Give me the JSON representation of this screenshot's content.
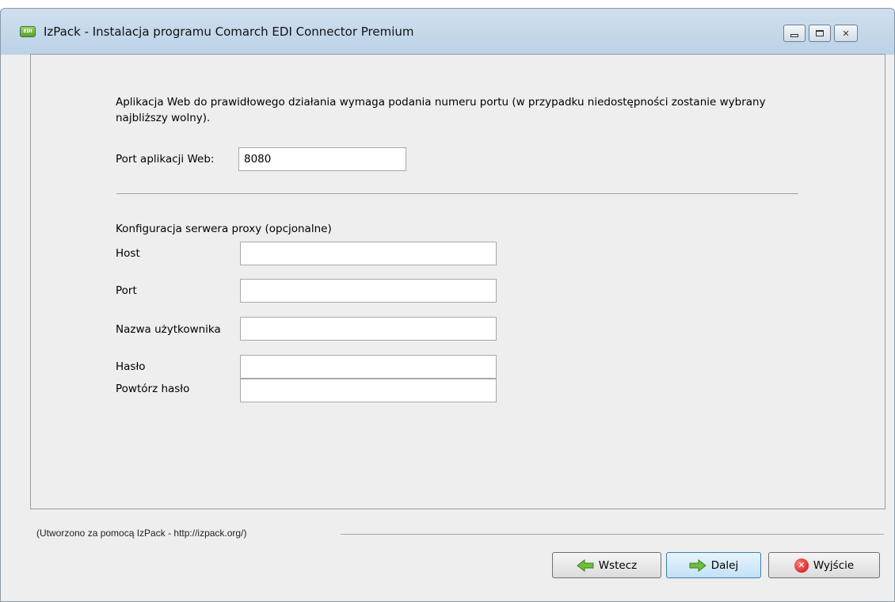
{
  "window": {
    "title": "IzPack - Instalacja programu Comarch EDI Connector Premium",
    "app_icon_text": "EDI",
    "min_glyph": "minimize-icon",
    "max_glyph": "maximize-icon",
    "close_glyph": "✕"
  },
  "web": {
    "description": "Aplikacja Web do prawidłowego działania wymaga podania numeru portu (w przypadku niedostępności zostanie wybrany najbliższy wolny).",
    "port_label": "Port aplikacji Web:",
    "port_value": "8080"
  },
  "proxy": {
    "heading": "Konfiguracja serwera proxy (opcjonalne)",
    "host_label": "Host",
    "host_value": "",
    "port_label": "Port",
    "port_value": "",
    "user_label": "Nazwa użytkownika",
    "user_value": "",
    "password_label": "Hasło",
    "password_value": "",
    "repeat_label": "Powtórz hasło",
    "repeat_value": ""
  },
  "footer": {
    "credit": "(Utworzono za pomocą IzPack - http://izpack.org/)"
  },
  "buttons": {
    "back": "Wstecz",
    "next": "Dalej",
    "exit": "Wyjście"
  },
  "colors": {
    "arrow_green": "#6cbf3a",
    "exit_red": "#d01818"
  }
}
